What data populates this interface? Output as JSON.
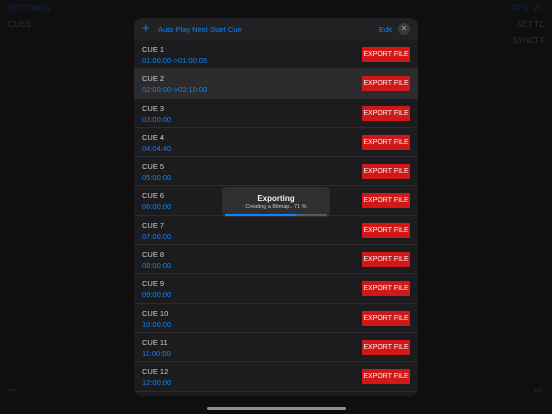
{
  "background": {
    "settings_label": "SETTINGS",
    "cues_label": "CUES",
    "fps_label": "FPS: 25",
    "set_label": "SET",
    "tc_label": "TC",
    "sync_label": "SYNC",
    "tx_label": "TX"
  },
  "header": {
    "add_icon": "+",
    "auto_play_next": "Auto Play Next",
    "start_cue": "Start Cue",
    "edit": "Edit",
    "close_icon": "✕"
  },
  "cues": [
    {
      "name": "CUE 1",
      "time": "01:00:00->01:00:05"
    },
    {
      "name": "CUE 2",
      "time": "02:00:00->02:10:00"
    },
    {
      "name": "CUE 3",
      "time": "03:00:00"
    },
    {
      "name": "CUE 4",
      "time": "04:04:40"
    },
    {
      "name": "CUE 5",
      "time": "05:00:00"
    },
    {
      "name": "CUE 6",
      "time": "06:00:00"
    },
    {
      "name": "CUE 7",
      "time": "07:00:00"
    },
    {
      "name": "CUE 8",
      "time": "08:00:00"
    },
    {
      "name": "CUE 9",
      "time": "09:00:00"
    },
    {
      "name": "CUE 10",
      "time": "10:00:00"
    },
    {
      "name": "CUE 11",
      "time": "11:00:00"
    },
    {
      "name": "CUE 12",
      "time": "12:00:00"
    }
  ],
  "export_label": "EXPORT FILE",
  "selected_cue_index": 1,
  "hud": {
    "title": "Exporting",
    "subtitle": "Creating a Bitmap.. 71 %",
    "progress": 0.71
  },
  "colors": {
    "accent": "#0a84ff",
    "export_button": "#d01818"
  }
}
